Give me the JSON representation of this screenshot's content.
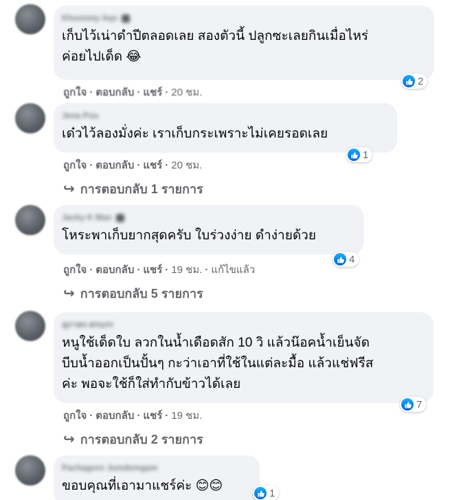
{
  "comments": [
    {
      "author": "Khunnmy Aqs",
      "text": "เก็บไว้เน่าดำปีตลอดเลย สองตัวนี้ ปลูกซะเลยกินเมื่อไหร่\nค่อยไปเด็ด 😂",
      "likes": "2",
      "like": "ถูกใจ",
      "reply": "ตอบกลับ",
      "share": "แชร์",
      "time": "20 ชม.",
      "edited": "",
      "replies": ""
    },
    {
      "author": "Jena Pou",
      "text": "เด๋วไว้ลองมั่งค่ะ เราเก็บกระเพราะไม่เคยรอดเลย",
      "likes": "1",
      "like": "ถูกใจ",
      "reply": "ตอบกลับ",
      "share": "แชร์",
      "time": "20 ชม.",
      "edited": "",
      "replies": "การตอบกลับ 1 รายการ"
    },
    {
      "author": "Jacky K Man",
      "text": "โหระพาเก็บยากสุดครับ ใบร่วงง่าย ดำง่ายด้วย",
      "likes": "4",
      "like": "ถูกใจ",
      "reply": "ตอบกลับ",
      "share": "แชร์",
      "time": "19 ชม.",
      "edited": "แก้ไขแล้ว",
      "replies": "การตอบกลับ 5 รายการ"
    },
    {
      "author": "สุภาพร ศรนรร",
      "text": "หนูใช้เด็ดใบ ลวกในน้ำเดือดสัก 10 วิ แล้วน๊อคน้ำเย็นจัด\nบีบน้ำออกเป็นปั้นๆ กะว่าเอาที่ใช้ในแต่ละมื้อ แล้วแช่ฟรีส\nค่ะ พอจะใช้ก็ใส่ทำกับข้าวได้เลย",
      "likes": "7",
      "like": "ถูกใจ",
      "reply": "ตอบกลับ",
      "share": "แชร์",
      "time": "19 ชม.",
      "edited": "",
      "replies": "การตอบกลับ 2 รายการ"
    },
    {
      "author": "Pachagorn Jumdemgam",
      "text": "ขอบคุณที่เอามาแชร์ค่ะ 😊😊",
      "likes": "1",
      "like": "",
      "reply": "",
      "share": "",
      "time": "",
      "edited": "",
      "replies": ""
    }
  ],
  "icons": {
    "like": "thumbs-up-icon",
    "reply_arrow": "reply-arrow-icon"
  },
  "colors": {
    "bubble": "#f0f2f5",
    "like_blue": "#1877f2",
    "meta_gray": "#65676b"
  }
}
